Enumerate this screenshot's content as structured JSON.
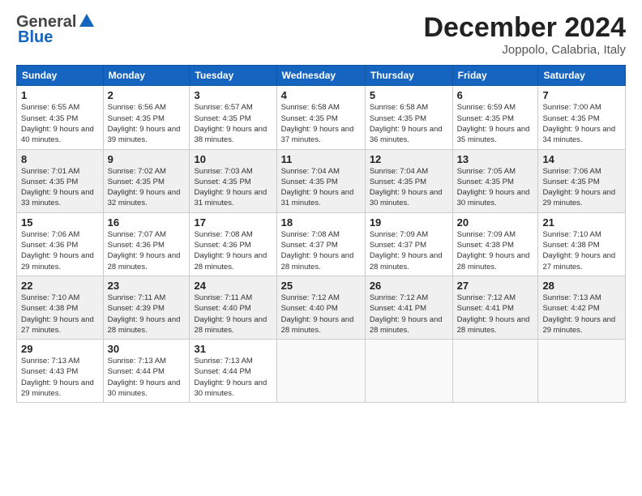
{
  "header": {
    "logo_general": "General",
    "logo_blue": "Blue",
    "month_title": "December 2024",
    "location": "Joppolo, Calabria, Italy"
  },
  "calendar": {
    "days_of_week": [
      "Sunday",
      "Monday",
      "Tuesday",
      "Wednesday",
      "Thursday",
      "Friday",
      "Saturday"
    ],
    "weeks": [
      [
        {
          "day": "1",
          "sunrise": "6:55 AM",
          "sunset": "4:35 PM",
          "daylight": "9 hours and 40 minutes."
        },
        {
          "day": "2",
          "sunrise": "6:56 AM",
          "sunset": "4:35 PM",
          "daylight": "9 hours and 39 minutes."
        },
        {
          "day": "3",
          "sunrise": "6:57 AM",
          "sunset": "4:35 PM",
          "daylight": "9 hours and 38 minutes."
        },
        {
          "day": "4",
          "sunrise": "6:58 AM",
          "sunset": "4:35 PM",
          "daylight": "9 hours and 37 minutes."
        },
        {
          "day": "5",
          "sunrise": "6:58 AM",
          "sunset": "4:35 PM",
          "daylight": "9 hours and 36 minutes."
        },
        {
          "day": "6",
          "sunrise": "6:59 AM",
          "sunset": "4:35 PM",
          "daylight": "9 hours and 35 minutes."
        },
        {
          "day": "7",
          "sunrise": "7:00 AM",
          "sunset": "4:35 PM",
          "daylight": "9 hours and 34 minutes."
        }
      ],
      [
        {
          "day": "8",
          "sunrise": "7:01 AM",
          "sunset": "4:35 PM",
          "daylight": "9 hours and 33 minutes."
        },
        {
          "day": "9",
          "sunrise": "7:02 AM",
          "sunset": "4:35 PM",
          "daylight": "9 hours and 32 minutes."
        },
        {
          "day": "10",
          "sunrise": "7:03 AM",
          "sunset": "4:35 PM",
          "daylight": "9 hours and 31 minutes."
        },
        {
          "day": "11",
          "sunrise": "7:04 AM",
          "sunset": "4:35 PM",
          "daylight": "9 hours and 31 minutes."
        },
        {
          "day": "12",
          "sunrise": "7:04 AM",
          "sunset": "4:35 PM",
          "daylight": "9 hours and 30 minutes."
        },
        {
          "day": "13",
          "sunrise": "7:05 AM",
          "sunset": "4:35 PM",
          "daylight": "9 hours and 30 minutes."
        },
        {
          "day": "14",
          "sunrise": "7:06 AM",
          "sunset": "4:35 PM",
          "daylight": "9 hours and 29 minutes."
        }
      ],
      [
        {
          "day": "15",
          "sunrise": "7:06 AM",
          "sunset": "4:36 PM",
          "daylight": "9 hours and 29 minutes."
        },
        {
          "day": "16",
          "sunrise": "7:07 AM",
          "sunset": "4:36 PM",
          "daylight": "9 hours and 28 minutes."
        },
        {
          "day": "17",
          "sunrise": "7:08 AM",
          "sunset": "4:36 PM",
          "daylight": "9 hours and 28 minutes."
        },
        {
          "day": "18",
          "sunrise": "7:08 AM",
          "sunset": "4:37 PM",
          "daylight": "9 hours and 28 minutes."
        },
        {
          "day": "19",
          "sunrise": "7:09 AM",
          "sunset": "4:37 PM",
          "daylight": "9 hours and 28 minutes."
        },
        {
          "day": "20",
          "sunrise": "7:09 AM",
          "sunset": "4:38 PM",
          "daylight": "9 hours and 28 minutes."
        },
        {
          "day": "21",
          "sunrise": "7:10 AM",
          "sunset": "4:38 PM",
          "daylight": "9 hours and 27 minutes."
        }
      ],
      [
        {
          "day": "22",
          "sunrise": "7:10 AM",
          "sunset": "4:38 PM",
          "daylight": "9 hours and 27 minutes."
        },
        {
          "day": "23",
          "sunrise": "7:11 AM",
          "sunset": "4:39 PM",
          "daylight": "9 hours and 28 minutes."
        },
        {
          "day": "24",
          "sunrise": "7:11 AM",
          "sunset": "4:40 PM",
          "daylight": "9 hours and 28 minutes."
        },
        {
          "day": "25",
          "sunrise": "7:12 AM",
          "sunset": "4:40 PM",
          "daylight": "9 hours and 28 minutes."
        },
        {
          "day": "26",
          "sunrise": "7:12 AM",
          "sunset": "4:41 PM",
          "daylight": "9 hours and 28 minutes."
        },
        {
          "day": "27",
          "sunrise": "7:12 AM",
          "sunset": "4:41 PM",
          "daylight": "9 hours and 28 minutes."
        },
        {
          "day": "28",
          "sunrise": "7:13 AM",
          "sunset": "4:42 PM",
          "daylight": "9 hours and 29 minutes."
        }
      ],
      [
        {
          "day": "29",
          "sunrise": "7:13 AM",
          "sunset": "4:43 PM",
          "daylight": "9 hours and 29 minutes."
        },
        {
          "day": "30",
          "sunrise": "7:13 AM",
          "sunset": "4:44 PM",
          "daylight": "9 hours and 30 minutes."
        },
        {
          "day": "31",
          "sunrise": "7:13 AM",
          "sunset": "4:44 PM",
          "daylight": "9 hours and 30 minutes."
        },
        null,
        null,
        null,
        null
      ]
    ]
  }
}
